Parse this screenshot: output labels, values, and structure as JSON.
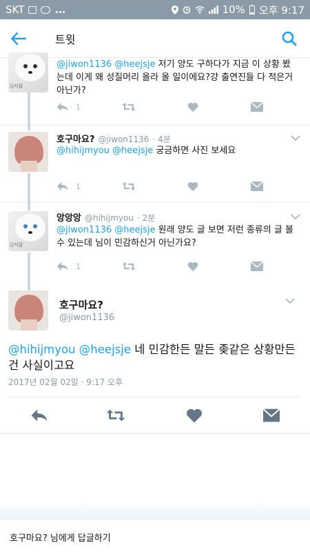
{
  "status_bar": {
    "carrier": "SKT",
    "battery": "10%",
    "time": "오후 9:17"
  },
  "header": {
    "title": "트윗"
  },
  "tweets": [
    {
      "name": "",
      "handle": "",
      "time": "",
      "mentions": "@jiwon1136 @heejsje",
      "text": " 저기 양도 구하다가 지금 이 상황 봤는데 이게 왜 성질머리 올라 올 일이에요?걍 출연진들 다 적은거 아닌가?",
      "reply_count": "1",
      "avatar_label": "당자말"
    },
    {
      "name": "호구마요?",
      "handle": "@jiwon1136",
      "time": "· 4분",
      "mentions": "@hihijmyou @heejsje",
      "text": " 궁금하면 사진 보세요",
      "reply_count": "1"
    },
    {
      "name": "앙앙앙",
      "handle": "@hihijmyou",
      "time": "· 2분",
      "mentions": "@jiwon1136 @heejsje",
      "text": " 원래 양도 글 보면 저런 종류의 글 볼 수 있는데 님이 민감하신거 아닌가요?",
      "reply_count": "1",
      "avatar_label": "당자말"
    }
  ],
  "main": {
    "name": "호구마요?",
    "handle": "@jiwon1136",
    "mentions": "@hihijmyou @heejsje",
    "text": " 네 민감한든 말든 좆같은 상황만든건 사실이고요",
    "date": "2017년 02월 02일 · 9:17 오후"
  },
  "reply_bar": {
    "placeholder": "호구마요? 님에게 답글하기"
  },
  "colors": {
    "accent": "#1da1f2",
    "icon_gray": "#aab8c2",
    "status_bar": "#8a9aa6"
  }
}
